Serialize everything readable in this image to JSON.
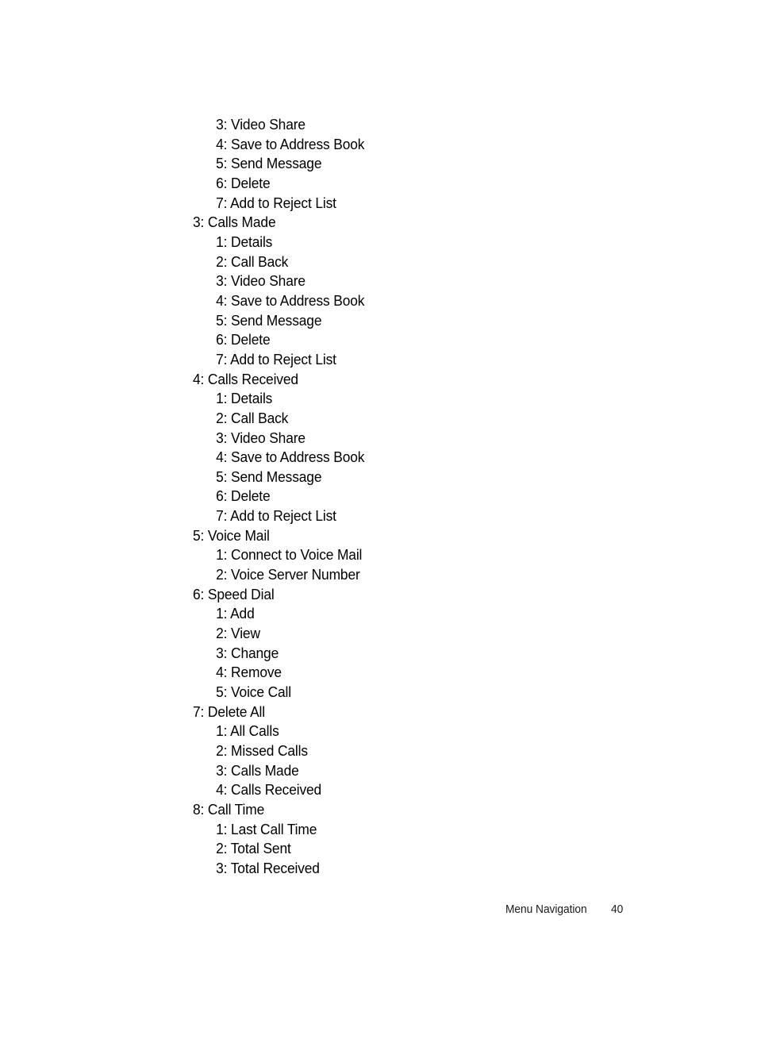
{
  "document": {
    "background_color": "#ffffff",
    "text_color": "#000000"
  },
  "menu_tree": {
    "lines": [
      {
        "level": 2,
        "text": "3: Video Share"
      },
      {
        "level": 2,
        "text": "4: Save to Address Book"
      },
      {
        "level": 2,
        "text": "5: Send Message"
      },
      {
        "level": 2,
        "text": "6: Delete"
      },
      {
        "level": 2,
        "text": "7: Add to Reject List"
      },
      {
        "level": 1,
        "text": "3: Calls Made"
      },
      {
        "level": 2,
        "text": "1: Details"
      },
      {
        "level": 2,
        "text": "2: Call Back"
      },
      {
        "level": 2,
        "text": "3: Video Share"
      },
      {
        "level": 2,
        "text": "4: Save to Address Book"
      },
      {
        "level": 2,
        "text": "5: Send Message"
      },
      {
        "level": 2,
        "text": "6: Delete"
      },
      {
        "level": 2,
        "text": "7: Add to Reject List"
      },
      {
        "level": 1,
        "text": "4: Calls Received"
      },
      {
        "level": 2,
        "text": "1: Details"
      },
      {
        "level": 2,
        "text": "2: Call Back"
      },
      {
        "level": 2,
        "text": "3: Video Share"
      },
      {
        "level": 2,
        "text": "4: Save to Address Book"
      },
      {
        "level": 2,
        "text": "5: Send Message"
      },
      {
        "level": 2,
        "text": "6: Delete"
      },
      {
        "level": 2,
        "text": "7: Add to Reject List"
      },
      {
        "level": 1,
        "text": "5: Voice Mail"
      },
      {
        "level": 2,
        "text": "1: Connect to Voice Mail"
      },
      {
        "level": 2,
        "text": "2: Voice Server Number"
      },
      {
        "level": 1,
        "text": "6: Speed Dial"
      },
      {
        "level": 2,
        "text": "1: Add"
      },
      {
        "level": 2,
        "text": "2: View"
      },
      {
        "level": 2,
        "text": "3: Change"
      },
      {
        "level": 2,
        "text": "4: Remove"
      },
      {
        "level": 2,
        "text": "5: Voice Call"
      },
      {
        "level": 1,
        "text": "7: Delete All"
      },
      {
        "level": 2,
        "text": "1: All Calls"
      },
      {
        "level": 2,
        "text": "2: Missed Calls"
      },
      {
        "level": 2,
        "text": "3: Calls Made"
      },
      {
        "level": 2,
        "text": "4: Calls Received"
      },
      {
        "level": 1,
        "text": "8: Call Time"
      },
      {
        "level": 2,
        "text": "1: Last Call Time"
      },
      {
        "level": 2,
        "text": "2: Total Sent"
      },
      {
        "level": 2,
        "text": "3: Total Received"
      }
    ]
  },
  "footer": {
    "chapter": "Menu Navigation",
    "page_number": "40"
  }
}
